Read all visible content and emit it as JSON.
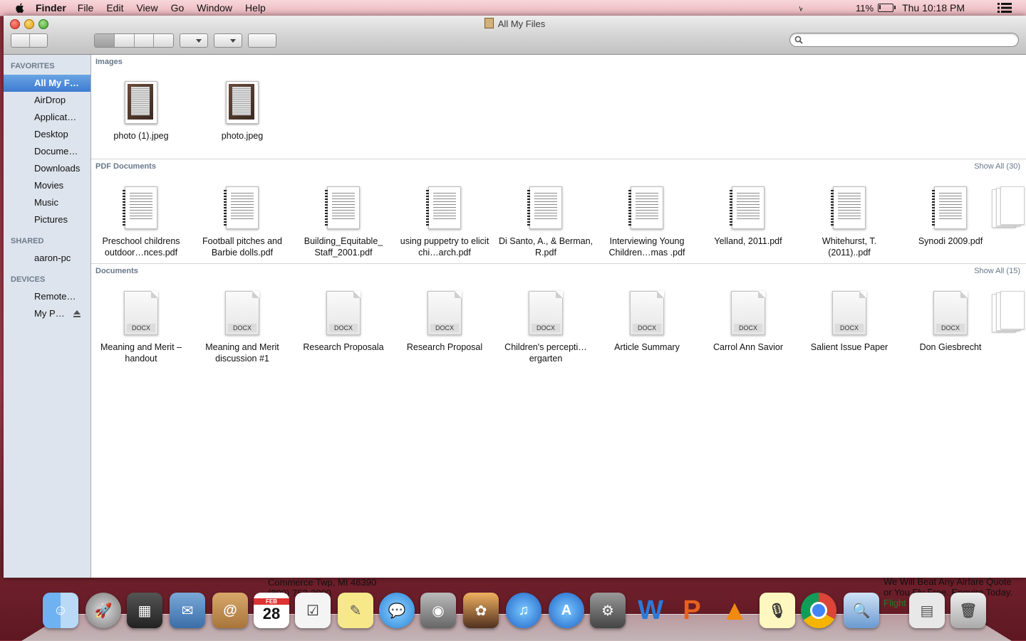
{
  "menubar": {
    "app_name": "Finder",
    "menus": [
      "File",
      "Edit",
      "View",
      "Go",
      "Window",
      "Help"
    ],
    "battery_percent": "11%",
    "battery_level": 0.11,
    "clock": "Thu 10:18 PM"
  },
  "window": {
    "title": "All My Files",
    "search_placeholder": ""
  },
  "sidebar": {
    "favorites_header": "FAVORITES",
    "favorites": [
      "All My F…",
      "AirDrop",
      "Applicat…",
      "Desktop",
      "Docume…",
      "Downloads",
      "Movies",
      "Music",
      "Pictures"
    ],
    "selected_index": 0,
    "shared_header": "SHARED",
    "shared": [
      "aaron-pc"
    ],
    "devices_header": "DEVICES",
    "devices": [
      "Remote…",
      "My P…"
    ]
  },
  "sections": {
    "images": {
      "header": "Images",
      "items": [
        "photo (1).jpeg",
        "photo.jpeg"
      ]
    },
    "pdf": {
      "header": "PDF Documents",
      "show_all": "Show All (30)",
      "items": [
        "Preschool childrens outdoor…nces.pdf",
        "Football pitches and Barbie dolls.pdf",
        "Building_Equitable_ Staff_2001.pdf",
        "using puppetry to elicit chi…arch.pdf",
        "Di Santo, A., & Berman, R.pdf",
        "Interviewing Young Children…mas .pdf",
        "Yelland, 2011.pdf",
        "Whitehurst, T. (2011)..pdf",
        "Synodi 2009.pdf"
      ]
    },
    "documents": {
      "header": "Documents",
      "show_all": "Show All (15)",
      "badge": "DOCX",
      "items": [
        "Meaning and Merit – handout",
        "Meaning and Merit discussion #1",
        "Research Proposala",
        "Research Proposal",
        "Children's percepti…ergarten",
        "Article Summary",
        "Carrol Ann Savior",
        "Salient Issue Paper",
        "Don Giesbrecht"
      ]
    }
  },
  "desktop": {
    "address_line1": "Commerce Twp, MI 48390",
    "address_line2": "(800) 753-2000",
    "ad_line1": "We Will Beat Any Airfare Quote",
    "ad_line2": "or You Fly Free. Enquire Today.",
    "ad_link": "Flight"
  },
  "dock": {
    "calendar_month": "FEB",
    "calendar_day": "28"
  },
  "colors": {
    "selection_blue": "#3d7bd0",
    "sidebar_bg": "#dde4ed",
    "section_header": "#68788a"
  }
}
